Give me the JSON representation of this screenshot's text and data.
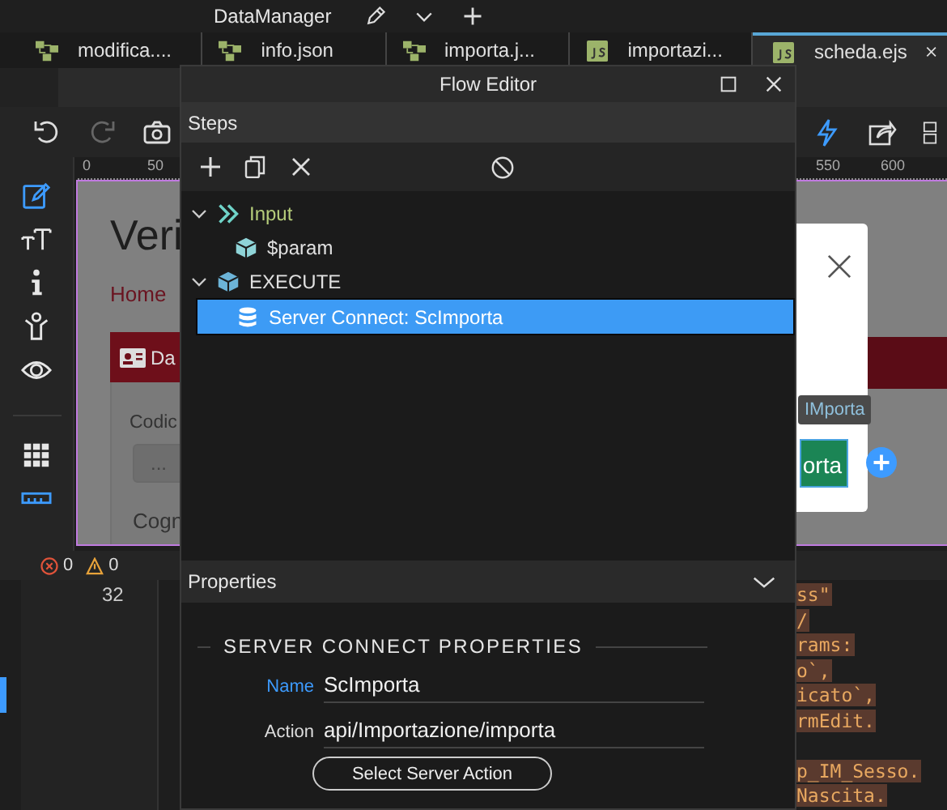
{
  "title_bar": {
    "title": "DataManager"
  },
  "tabs": [
    {
      "label": "modifica....",
      "kind": "flow",
      "selected": false
    },
    {
      "label": "info.json",
      "kind": "flow",
      "selected": false
    },
    {
      "label": "importa.j...",
      "kind": "flow",
      "selected": false
    },
    {
      "label": "importazi...",
      "kind": "js",
      "selected": false
    },
    {
      "label": "scheda.ejs",
      "kind": "js",
      "selected": true
    }
  ],
  "ruler": {
    "labels": [
      "0",
      "50",
      "550",
      "600"
    ]
  },
  "tools": [
    {
      "kind": "edit",
      "active": true
    },
    {
      "kind": "text",
      "active": false
    },
    {
      "kind": "info",
      "active": false
    },
    {
      "kind": "person",
      "active": false
    },
    {
      "kind": "eye",
      "active": false
    },
    {
      "kind": "grid",
      "active": false
    },
    {
      "kind": "ruler",
      "active": true
    }
  ],
  "canvas": {
    "heading": "Veri",
    "breadcrumb": "Home",
    "card_tab": "Da",
    "field_labels": [
      "Codic",
      "Cogn"
    ],
    "field_value": "...",
    "tooltip": "IMporta",
    "button": "orta"
  },
  "status": {
    "errors": "0",
    "warnings": "0"
  },
  "code": {
    "line_number": "32",
    "lines": [
      "ss\"",
      "/",
      "rams:",
      "o`,",
      "icato`,",
      "rmEdit."
    ],
    "lines_after_gap": [
      "p_IM_Sesso.",
      "Nascita."
    ]
  },
  "flow_editor": {
    "title": "Flow Editor",
    "steps_label": "Steps",
    "tree": [
      {
        "label": "Input",
        "kind": "input",
        "expanded": true,
        "selected": false,
        "children": [
          {
            "label": "$param",
            "kind": "param",
            "selected": false
          }
        ]
      },
      {
        "label": "EXECUTE",
        "kind": "execute",
        "expanded": true,
        "selected": false,
        "children": [
          {
            "label": "Server Connect: ScImporta",
            "kind": "server",
            "selected": true
          }
        ]
      }
    ],
    "properties": {
      "title": "Properties",
      "expanded": true,
      "section": "SERVER CONNECT PROPERTIES",
      "fields": [
        {
          "label": "Name",
          "value": "ScImporta",
          "focused": true
        },
        {
          "label": "Action",
          "value": "api/Importazione/importa",
          "focused": false
        }
      ],
      "button": "Select Server Action"
    }
  }
}
